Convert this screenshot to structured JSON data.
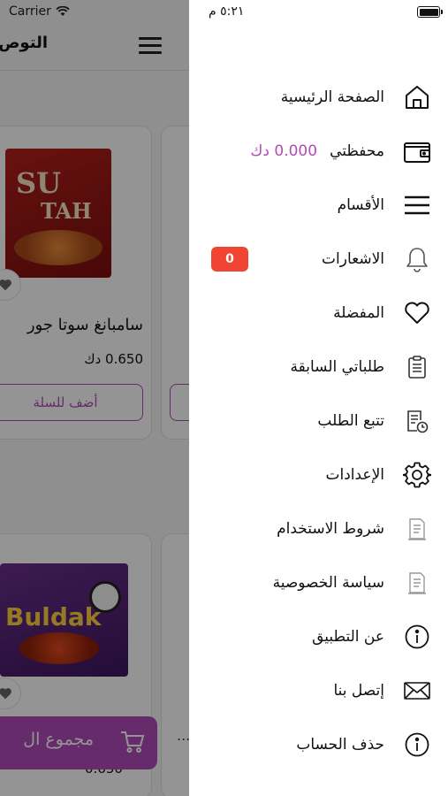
{
  "background": {
    "status_carrier": "Carrier",
    "header_title": "التوص",
    "product_1": {
      "name": "سامبانغ سوتا جور",
      "price": "0.650 دك",
      "add_to_cart": "أضف للسلة",
      "image_text": "SUTAH"
    },
    "product_2": {
      "image_text": "Buldak"
    },
    "cart_total_label": "مجموع ال",
    "dots": "...",
    "price_2": "0.650"
  },
  "drawer": {
    "status_time": "٥:٢١ م",
    "items": [
      {
        "label": "الصفحة الرئيسية",
        "icon": "home-icon"
      },
      {
        "label": "محفظتي",
        "value": "0.000 دك",
        "icon": "wallet-icon"
      },
      {
        "label": "الأقسام",
        "icon": "categories-menu-icon"
      },
      {
        "label": "الاشعارات",
        "badge": "0",
        "icon": "bell-icon"
      },
      {
        "label": "المفضلة",
        "icon": "heart-icon"
      },
      {
        "label": "طلباتي السابقة",
        "icon": "orders-clipboard-icon"
      },
      {
        "label": "تتبع الطلب",
        "icon": "track-order-icon"
      },
      {
        "label": "الإعدادات",
        "icon": "gear-icon"
      },
      {
        "label": "شروط الاستخدام",
        "icon": "terms-document-icon"
      },
      {
        "label": "سياسة الخصوصية",
        "icon": "privacy-document-icon"
      },
      {
        "label": "عن التطبيق",
        "icon": "info-icon"
      },
      {
        "label": "إتصل بنا",
        "icon": "mail-icon"
      },
      {
        "label": "حذف الحساب",
        "icon": "delete-account-info-icon"
      }
    ]
  },
  "colors": {
    "accent": "#b04bb8",
    "badge": "#f14432",
    "text": "#111111"
  }
}
